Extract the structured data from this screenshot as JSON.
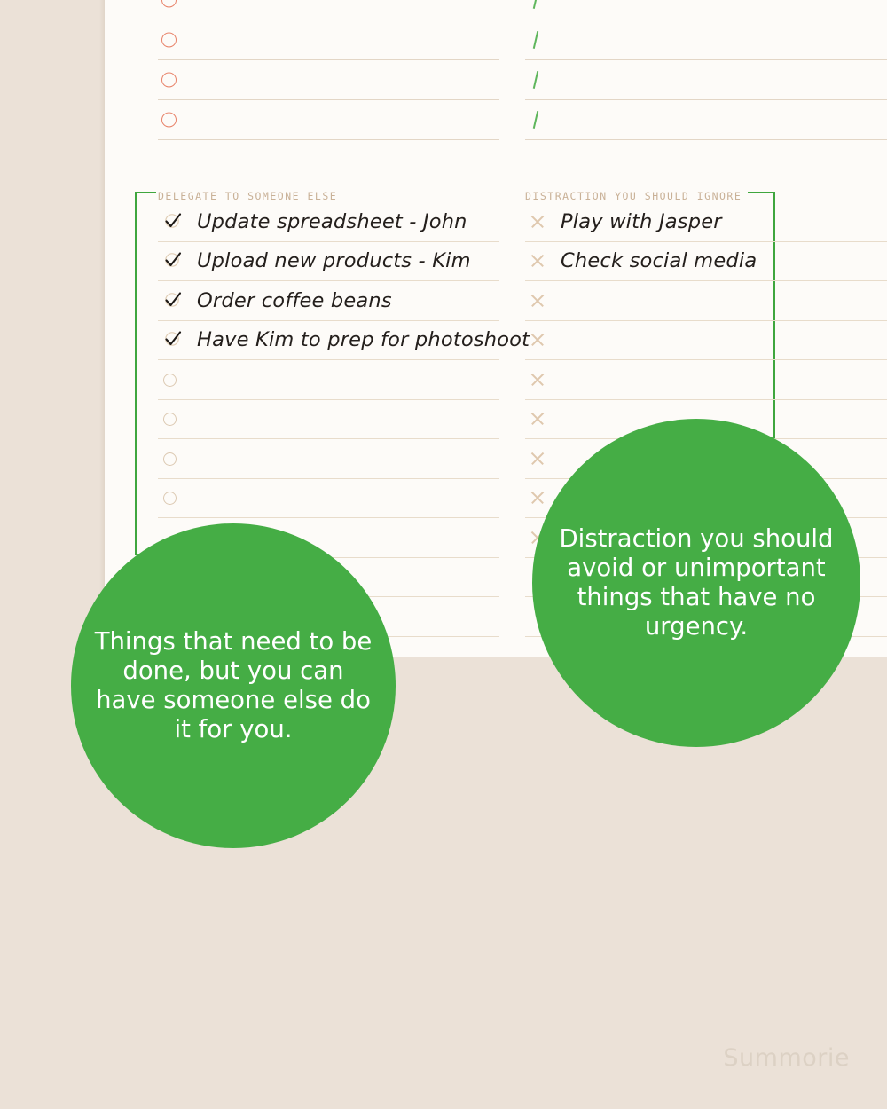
{
  "colors": {
    "background": "#EBE1D7",
    "paper": "#FDFBF8",
    "accent_green": "#45AD45",
    "bracket_green": "#3FA63E",
    "ring_orange": "#E8836A",
    "rule_line": "#E8DCCB",
    "label_tan": "#C9B197",
    "watermark": "#DCD1C4"
  },
  "top_quadrants": {
    "left": {
      "icon": "circle-outline-icon",
      "rows": [
        {
          "text": ""
        },
        {
          "text": ""
        },
        {
          "text": ""
        },
        {
          "text": ""
        }
      ]
    },
    "right": {
      "icon": "slash-icon",
      "rows": [
        {
          "text": ""
        },
        {
          "text": ""
        },
        {
          "text": ""
        },
        {
          "text": ""
        }
      ]
    }
  },
  "delegate_section": {
    "header": "DELEGATE TO SOMEONE ELSE",
    "rows": [
      {
        "icon": "check-icon",
        "text": "Update spreadsheet - John"
      },
      {
        "icon": "check-icon",
        "text": "Upload new products - Kim"
      },
      {
        "icon": "check-icon",
        "text": "Order coffee beans"
      },
      {
        "icon": "check-icon",
        "text": "Have Kim to prep for photoshoot"
      },
      {
        "icon": "circle-outline-icon",
        "text": ""
      },
      {
        "icon": "circle-outline-icon",
        "text": ""
      },
      {
        "icon": "circle-outline-icon",
        "text": ""
      },
      {
        "icon": "circle-outline-icon",
        "text": ""
      },
      {
        "icon": "none",
        "text": ""
      },
      {
        "icon": "none",
        "text": ""
      },
      {
        "icon": "none",
        "text": ""
      }
    ]
  },
  "distraction_section": {
    "header": "DISTRACTION YOU SHOULD IGNORE",
    "rows": [
      {
        "icon": "x-icon",
        "text": "Play with Jasper"
      },
      {
        "icon": "x-icon",
        "text": "Check social media"
      },
      {
        "icon": "x-icon",
        "text": ""
      },
      {
        "icon": "x-icon",
        "text": ""
      },
      {
        "icon": "x-icon",
        "text": ""
      },
      {
        "icon": "x-icon",
        "text": ""
      },
      {
        "icon": "x-icon",
        "text": ""
      },
      {
        "icon": "x-icon",
        "text": ""
      },
      {
        "icon": "x-icon",
        "text": ""
      },
      {
        "icon": "none",
        "text": ""
      },
      {
        "icon": "none",
        "text": ""
      }
    ]
  },
  "callouts": {
    "delegate": "Things that need to be done, but you can have someone else do it for you.",
    "distraction": "Distraction you should avoid or unimportant things that have no urgency."
  },
  "watermark": "Summorie"
}
